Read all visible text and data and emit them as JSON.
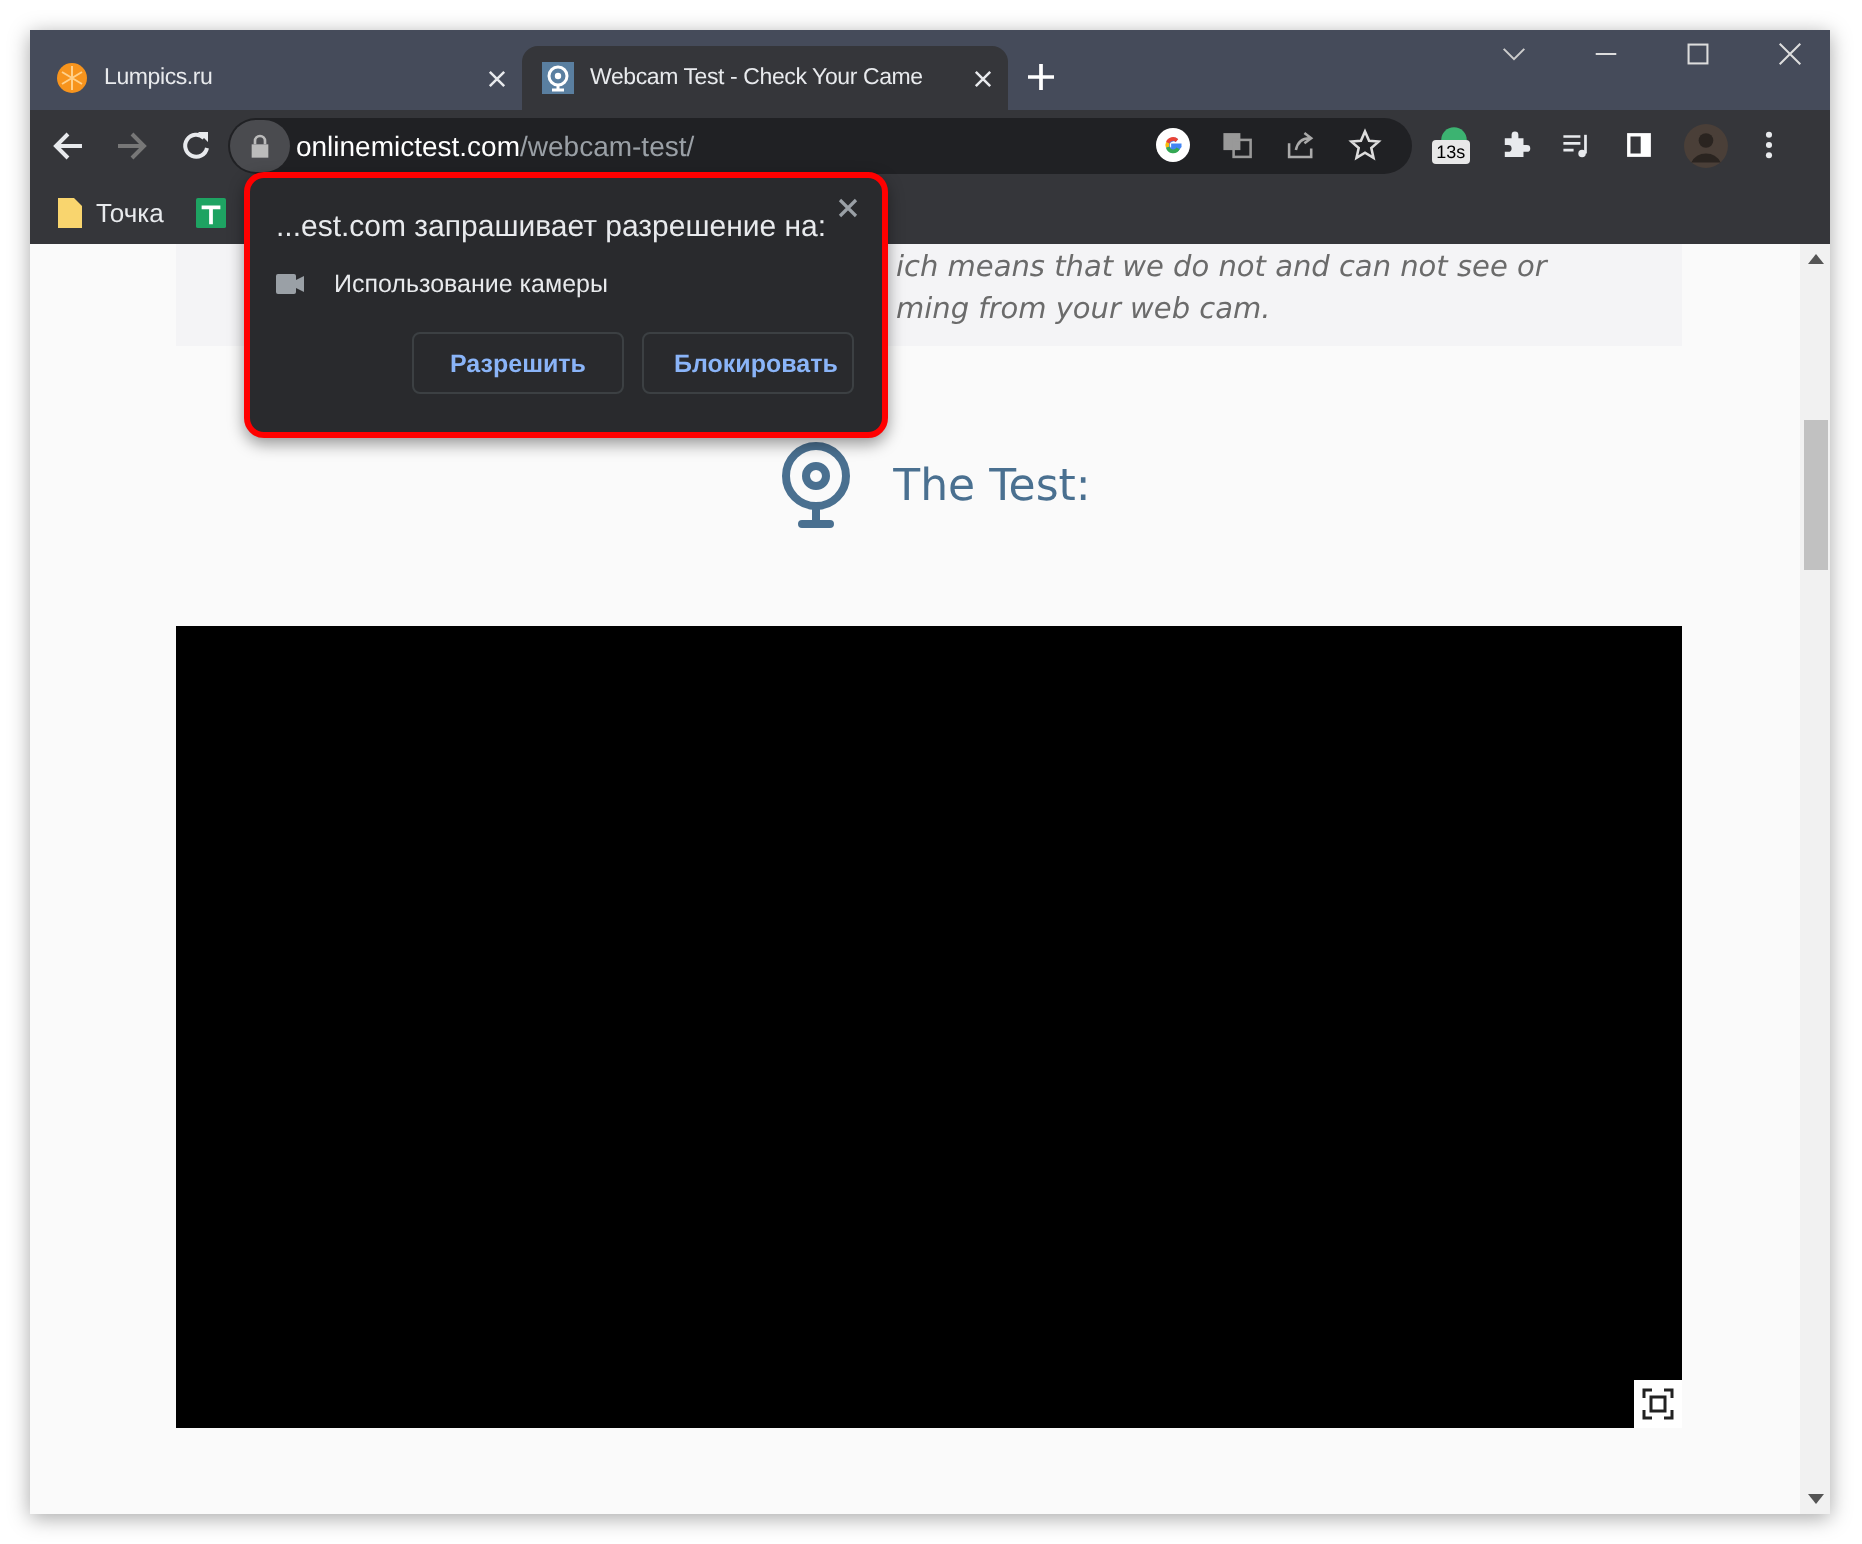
{
  "tabs": [
    {
      "title": "Lumpics.ru",
      "kind": "orange",
      "selected": false
    },
    {
      "title": "Webcam Test - Check Your Came",
      "kind": "webcam",
      "selected": true
    }
  ],
  "nav_buttons": [
    {
      "kind": "back",
      "disabled": false
    },
    {
      "kind": "forward",
      "disabled": true
    },
    {
      "kind": "reload",
      "disabled": false
    }
  ],
  "address": {
    "domain": "onlinemictest.com",
    "path": "/webcam-test/"
  },
  "extension_badge": "13s",
  "bookmarks": [
    {
      "kind": "folder",
      "label": "Точка"
    },
    {
      "kind": "sheet"
    }
  ],
  "page": {
    "intro_lines": [
      "ich means that we do not and can not see or",
      "ming from your web cam."
    ],
    "heading": "The Test:"
  },
  "permission_popup": {
    "title": "...est.com запрашивает разрешение на:",
    "permission": "Использование камеры",
    "buttons": [
      "Разрешить",
      "Блокировать"
    ]
  }
}
